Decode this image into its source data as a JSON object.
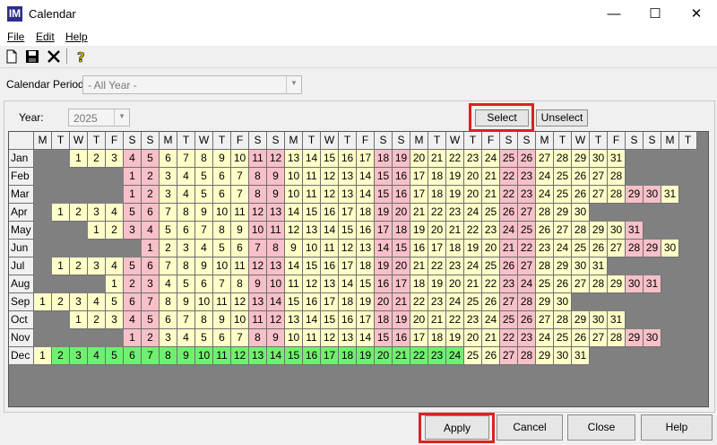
{
  "window": {
    "title": "Calendar",
    "icon": "IM",
    "minimize": "—",
    "maximize": "☐",
    "close": "✕"
  },
  "menu": [
    "File",
    "Edit",
    "Help"
  ],
  "toolbar": [
    "new-icon",
    "save-icon",
    "delete-icon",
    "help-icon"
  ],
  "period": {
    "label": "Calendar Period:",
    "value": "- All Year -"
  },
  "year": {
    "label": "Year:",
    "value": "2025"
  },
  "buttons": {
    "select": "Select",
    "unselect": "Unselect",
    "apply": "Apply",
    "cancel": "Cancel",
    "close": "Close",
    "help": "Help"
  },
  "weekday_headers": [
    "M",
    "T",
    "W",
    "T",
    "F",
    "S",
    "S",
    "M",
    "T",
    "W",
    "T",
    "F",
    "S",
    "S",
    "M",
    "T",
    "W",
    "T",
    "F",
    "S",
    "S",
    "M",
    "T",
    "W",
    "T",
    "F",
    "S",
    "S",
    "M",
    "T",
    "W",
    "T",
    "F",
    "S",
    "S",
    "M",
    "T"
  ],
  "months": [
    {
      "name": "Jan",
      "start": 2,
      "days": 31,
      "selected": []
    },
    {
      "name": "Feb",
      "start": 5,
      "days": 28,
      "selected": []
    },
    {
      "name": "Mar",
      "start": 5,
      "days": 31,
      "selected": []
    },
    {
      "name": "Apr",
      "start": 1,
      "days": 30,
      "selected": []
    },
    {
      "name": "May",
      "start": 3,
      "days": 31,
      "selected": []
    },
    {
      "name": "Jun",
      "start": 6,
      "days": 30,
      "selected": []
    },
    {
      "name": "Jul",
      "start": 1,
      "days": 31,
      "selected": []
    },
    {
      "name": "Aug",
      "start": 4,
      "days": 31,
      "selected": []
    },
    {
      "name": "Sep",
      "start": 0,
      "days": 30,
      "selected": []
    },
    {
      "name": "Oct",
      "start": 2,
      "days": 31,
      "selected": []
    },
    {
      "name": "Nov",
      "start": 5,
      "days": 30,
      "selected": []
    },
    {
      "name": "Dec",
      "start": 0,
      "days": 31,
      "selected": [
        2,
        3,
        4,
        5,
        6,
        7,
        8,
        9,
        10,
        11,
        12,
        13,
        14,
        15,
        16,
        17,
        18,
        19,
        20,
        21,
        22,
        23,
        24
      ]
    }
  ],
  "colors": {
    "weekday": "#ffffc8",
    "weekend": "#f8c0c8",
    "selected": "#70f070",
    "empty": "#808080",
    "highlight": "#e02020"
  }
}
